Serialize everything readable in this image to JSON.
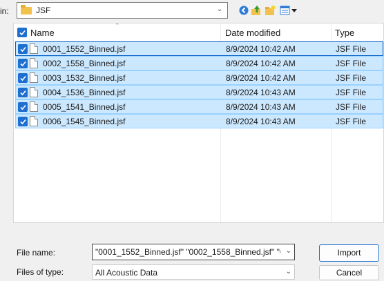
{
  "look_in": {
    "label": "in:",
    "value": "JSF"
  },
  "toolbar": {
    "icons": [
      "back-icon",
      "up-folder-icon",
      "new-folder-icon",
      "view-menu-icon"
    ]
  },
  "file_list": {
    "columns": {
      "name": "Name",
      "date": "Date modified",
      "type": "Type"
    },
    "rows": [
      {
        "name": "0001_1552_Binned.jsf",
        "date": "8/9/2024 10:42 AM",
        "type": "JSF File"
      },
      {
        "name": "0002_1558_Binned.jsf",
        "date": "8/9/2024 10:42 AM",
        "type": "JSF File"
      },
      {
        "name": "0003_1532_Binned.jsf",
        "date": "8/9/2024 10:42 AM",
        "type": "JSF File"
      },
      {
        "name": "0004_1536_Binned.jsf",
        "date": "8/9/2024 10:43 AM",
        "type": "JSF File"
      },
      {
        "name": "0005_1541_Binned.jsf",
        "date": "8/9/2024 10:43 AM",
        "type": "JSF File"
      },
      {
        "name": "0006_1545_Binned.jsf",
        "date": "8/9/2024 10:43 AM",
        "type": "JSF File"
      }
    ]
  },
  "file_name": {
    "label": "File name:",
    "value": "\"0001_1552_Binned.jsf\" \"0002_1558_Binned.jsf\" \"00"
  },
  "file_type": {
    "label": "Files of type:",
    "value": "All Acoustic Data"
  },
  "buttons": {
    "import": "Import",
    "cancel": "Cancel"
  },
  "colors": {
    "selection_bg": "#cce8ff",
    "checkbox": "#1e6fd0",
    "folder": "#f2c14e"
  }
}
